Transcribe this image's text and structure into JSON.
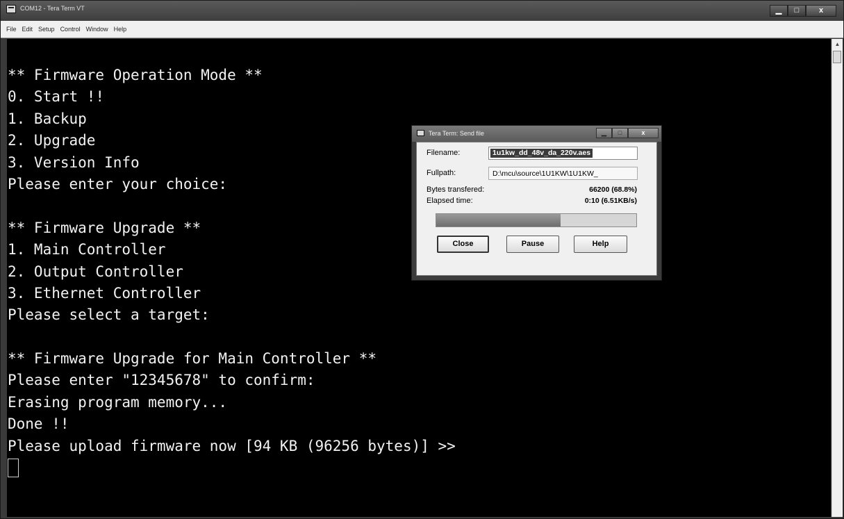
{
  "window": {
    "title": "COM12 - Tera Term VT",
    "minimize_label": "▁",
    "maximize_label": "□",
    "close_label": "x"
  },
  "menu": [
    "File",
    "Edit",
    "Setup",
    "Control",
    "Window",
    "Help"
  ],
  "terminal": {
    "lines": [
      "** Firmware Operation Mode **",
      "0. Start !!",
      "1. Backup",
      "2. Upgrade",
      "3. Version Info",
      "Please enter your choice:",
      "",
      "** Firmware Upgrade **",
      "1. Main Controller",
      "2. Output Controller",
      "3. Ethernet Controller",
      "Please select a target:",
      "",
      "** Firmware Upgrade for Main Controller **",
      "Please enter \"12345678\" to confirm:",
      "Erasing program memory...",
      "Done !!",
      "Please upload firmware now [94 KB (96256 bytes)] >>"
    ]
  },
  "send_dialog": {
    "title": "Tera Term: Send file",
    "close_label": "x",
    "filename_label": "Filename:",
    "filename_value": "1u1kw_dd_48v_da_220v.aes",
    "fullpath_label": "Fullpath:",
    "fullpath_value": "D:\\mcu\\source\\1U1KW\\1U1KW_",
    "bytes_label": "Bytes transfered:",
    "bytes_value": "66200 (68.8%)",
    "elapsed_label": "Elapsed time:",
    "elapsed_value": "0:10 (6.51KB/s)",
    "progress_fraction": 0.62,
    "buttons": {
      "close": "Close",
      "pause": "Pause",
      "help": "Help"
    }
  }
}
